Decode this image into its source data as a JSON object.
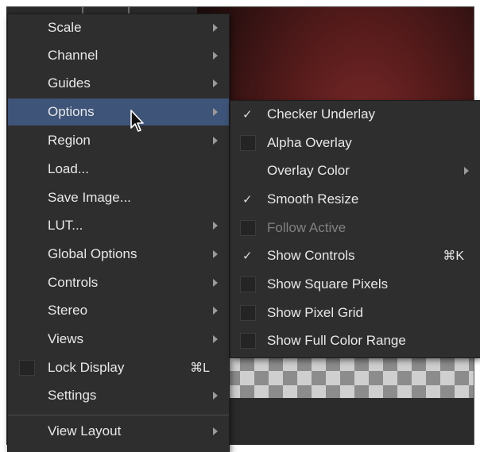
{
  "main_menu": {
    "items": [
      {
        "label": "Scale",
        "submenu": true
      },
      {
        "label": "Channel",
        "submenu": true
      },
      {
        "label": "Guides",
        "submenu": true
      },
      {
        "label": "Options",
        "submenu": true,
        "highlighted": true
      },
      {
        "label": "Region",
        "submenu": true
      },
      {
        "label": "Load...",
        "submenu": false
      },
      {
        "label": "Save Image...",
        "submenu": false
      },
      {
        "label": "LUT...",
        "submenu": true
      },
      {
        "label": "Global Options",
        "submenu": true
      },
      {
        "label": "Controls",
        "submenu": true
      },
      {
        "label": "Stereo",
        "submenu": true
      },
      {
        "label": "Views",
        "submenu": true
      },
      {
        "label": "Lock Display",
        "shortcut": "⌘L",
        "checkbox": true,
        "checked": false
      },
      {
        "label": "Settings",
        "submenu": true
      },
      {
        "label": "View Layout",
        "submenu": true
      }
    ]
  },
  "options_submenu": {
    "items": [
      {
        "label": "Checker Underlay",
        "checked": true
      },
      {
        "label": "Alpha Overlay",
        "checked": false
      },
      {
        "label": "Overlay Color",
        "submenu": true
      },
      {
        "label": "Smooth Resize",
        "checked": true
      },
      {
        "label": "Follow Active",
        "checked": false,
        "disabled": true
      },
      {
        "label": "Show Controls",
        "checked": true,
        "shortcut": "⌘K"
      },
      {
        "label": "Show Square Pixels",
        "checked": false
      },
      {
        "label": "Show Pixel Grid",
        "checked": false
      },
      {
        "label": "Show Full Color Range",
        "checked": false
      }
    ]
  },
  "glyphs": {
    "check": "✓"
  },
  "colors": {
    "menu_bg": "#2e2e2e",
    "highlight": "#3e5478",
    "text": "#e8e8e8",
    "disabled_text": "#808080"
  }
}
